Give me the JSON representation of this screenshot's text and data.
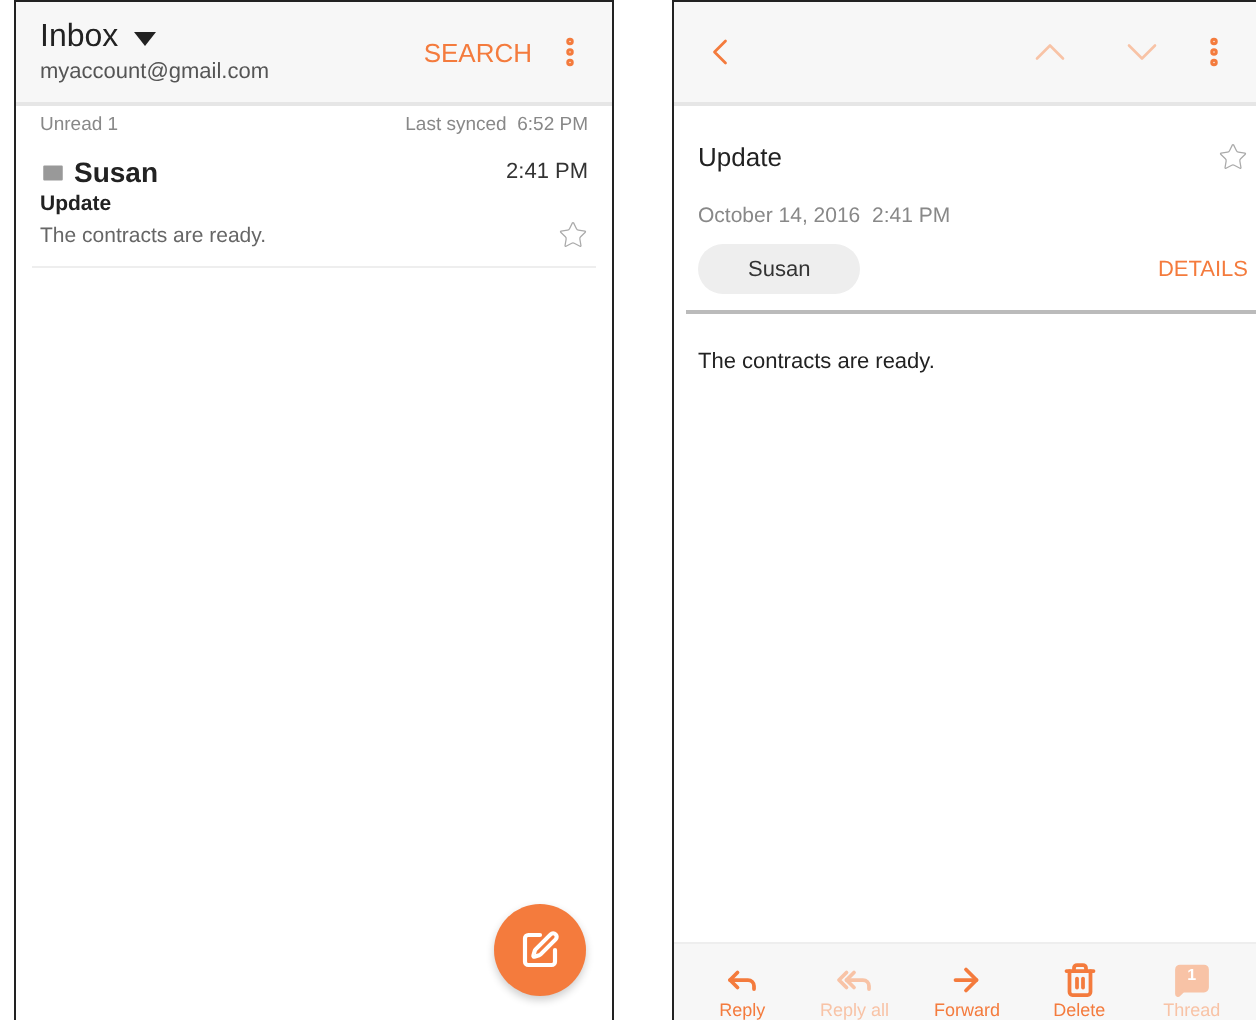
{
  "inbox": {
    "title": "Inbox",
    "account": "myaccount@gmail.com",
    "search": "SEARCH",
    "unread": "Unread 1",
    "last_synced": "Last synced  6:52 PM",
    "messages": [
      {
        "sender": "Susan",
        "time": "2:41 PM",
        "subject": "Update",
        "preview": "The contracts are ready.",
        "unread": true,
        "starred": false
      }
    ]
  },
  "detail": {
    "subject": "Update",
    "starred": false,
    "date": "October 14, 2016  2:41 PM",
    "sender": "Susan",
    "details": "DETAILS",
    "body": "The contracts are ready.",
    "actions": [
      {
        "kind": "reply",
        "label": "Reply",
        "disabled": false
      },
      {
        "kind": "reply_all",
        "label": "Reply all",
        "disabled": true
      },
      {
        "kind": "forward",
        "label": "Forward",
        "disabled": false
      },
      {
        "kind": "delete",
        "label": "Delete",
        "disabled": false
      },
      {
        "kind": "thread",
        "label": "Thread",
        "disabled": true,
        "badge": "1"
      }
    ]
  }
}
